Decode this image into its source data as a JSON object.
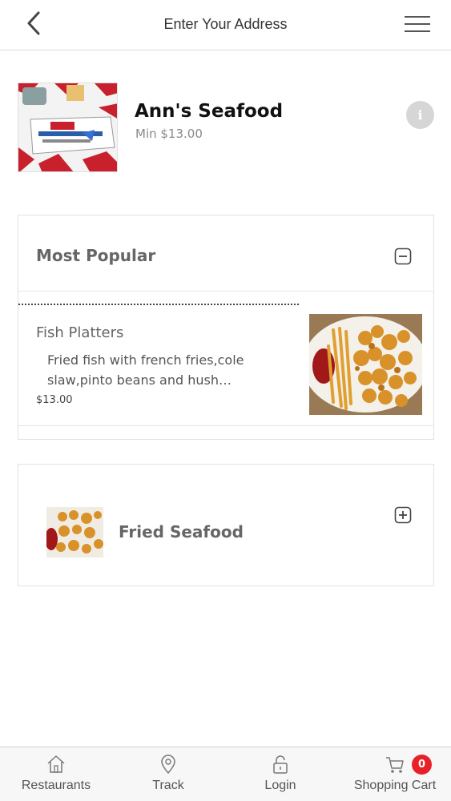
{
  "header": {
    "title": "Enter Your Address"
  },
  "restaurant": {
    "name": "Ann's Seafood",
    "min_order": "Min $13.00"
  },
  "categories": [
    {
      "title": "Most Popular",
      "expanded": true,
      "items": [
        {
          "name": "Fish Platters",
          "description": "Fried fish with french fries,cole slaw,pinto beans and hush…",
          "price": "$13.00"
        }
      ]
    },
    {
      "title": "Fried Seafood",
      "expanded": false
    }
  ],
  "bottom_nav": {
    "items": [
      {
        "label": "Restaurants",
        "icon": "home-icon"
      },
      {
        "label": "Track",
        "icon": "location-pin-icon"
      },
      {
        "label": "Login",
        "icon": "unlock-icon"
      },
      {
        "label": "Shopping Cart",
        "icon": "cart-icon"
      }
    ],
    "cart_count": "0"
  },
  "colors": {
    "badge": "#e8202a",
    "header_border": "#d9d9d9"
  }
}
